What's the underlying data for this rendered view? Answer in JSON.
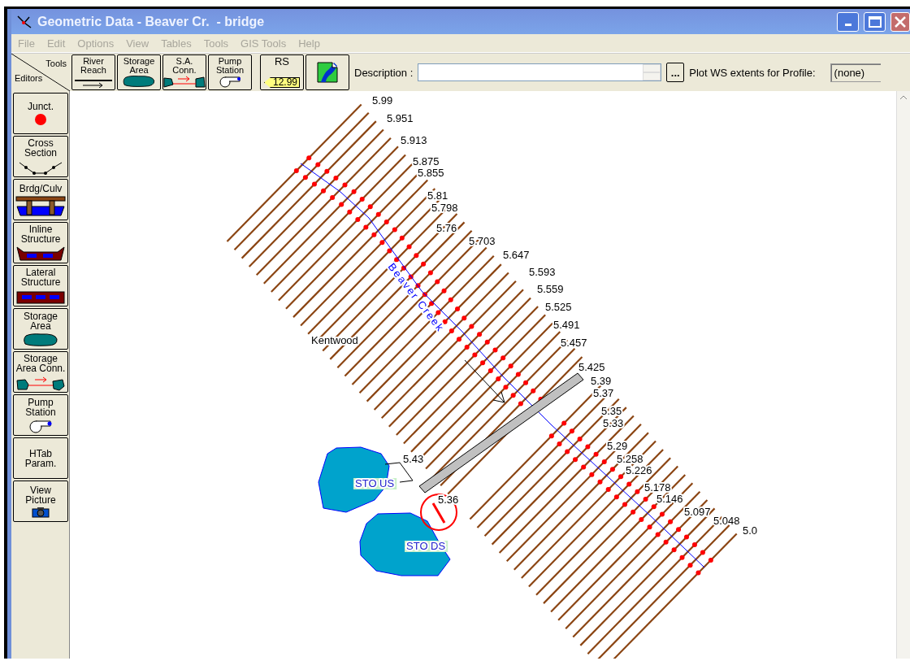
{
  "window": {
    "title": "Geometric Data - Beaver Cr.  - bridge"
  },
  "menu": [
    "File",
    "Edit",
    "Options",
    "View",
    "Tables",
    "Tools",
    "GIS Tools",
    "Help"
  ],
  "toolbar": {
    "corner_top": "Tools",
    "corner_bottom": "Editors",
    "tools": [
      "River Reach",
      "Storage Area",
      "S.A. Conn.",
      "Pump Station"
    ],
    "rs_button": {
      "label": "RS",
      "tag": "12.99"
    },
    "description_label": "Description :",
    "more_button": "...",
    "profile": {
      "label": "Plot WS extents for Profile:",
      "value": "(none)"
    }
  },
  "editors": [
    "Junct.",
    "Cross Section",
    "Brdg/Culv",
    "Inline Structure",
    "Lateral Structure",
    "Storage Area",
    "Storage Area Conn.",
    "Pump Station",
    "HTab Param.",
    "View Picture"
  ],
  "canvas": {
    "river_label": "Beaver Creek",
    "place_label": "Kentwood",
    "cross_sections": [
      "5.99",
      "5.951",
      "5.913",
      "5.875",
      "5.855",
      "5.81",
      "5.798",
      "5.76",
      "5.703",
      "5.647",
      "5.593",
      "5.559",
      "5.525",
      "5.491",
      "5.457",
      "5.425",
      "5.39",
      "5.37",
      "5.35",
      "5.33",
      "5.29",
      "5.258",
      "5.226",
      "5.178",
      "5.146",
      "5.097",
      "5.048",
      "5.0"
    ],
    "storage_areas": [
      "STO US",
      "STO DS"
    ],
    "connection_labels": [
      "5.43",
      "5.36"
    ]
  }
}
